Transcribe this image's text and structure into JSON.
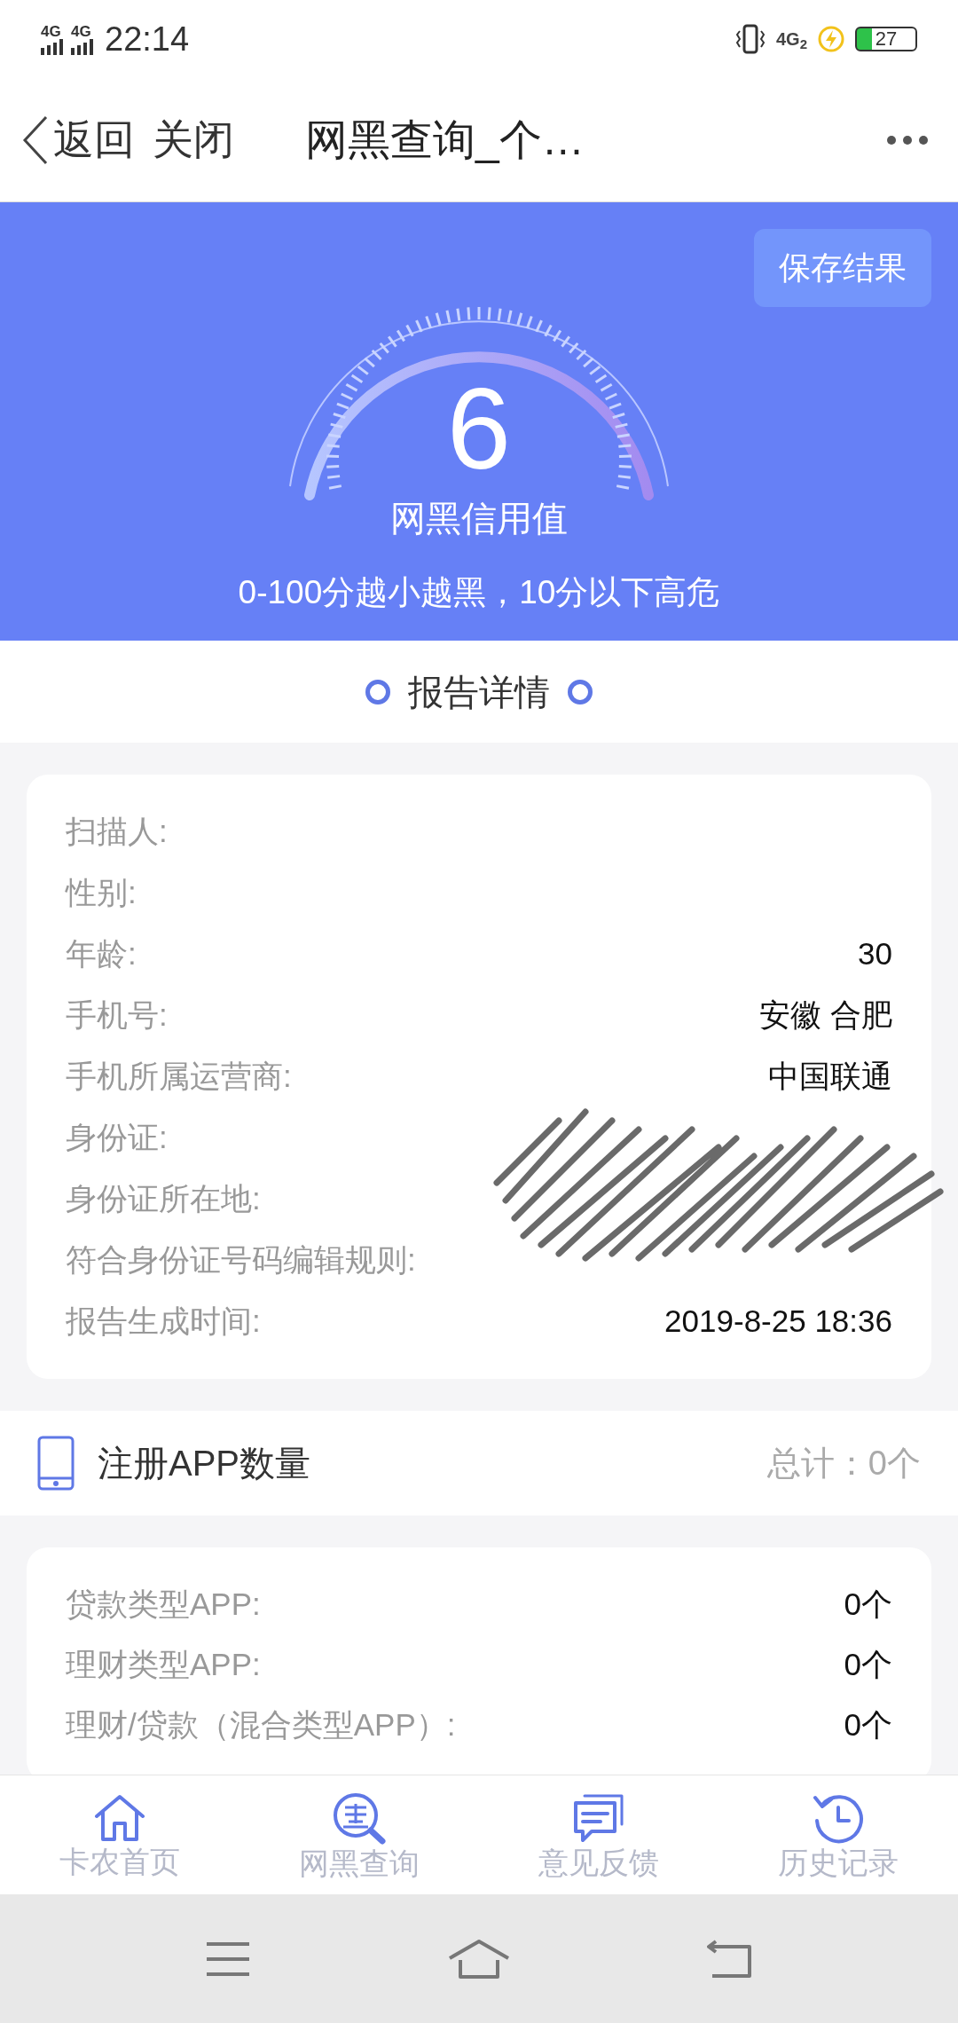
{
  "status_bar": {
    "signals": [
      "4G",
      "4G"
    ],
    "time": "22:14",
    "network": "4G$_{2}$",
    "battery": "27"
  },
  "nav_bar": {
    "back": "返回",
    "close": "关闭",
    "title": "网黑查询_个…"
  },
  "score_banner": {
    "save_button": "保存结果",
    "score": "6",
    "score_label": "网黑信用值",
    "note": "0-100分越小越黑，10分以下高危"
  },
  "report_heading": "报告详情",
  "report": [
    {
      "label": "扫描人:"
    },
    {
      "label": "性别:"
    },
    {
      "label": "年龄:",
      "value": "30"
    },
    {
      "label": "手机号:",
      "value": "安徽 合肥"
    },
    {
      "label": "手机所属运营商:",
      "value": "中国联通"
    },
    {
      "label": "身份证:"
    },
    {
      "label": "身份证所在地:"
    },
    {
      "label": "符合身份证号码编辑规则:"
    },
    {
      "label": "报告生成时间:",
      "value": "2019-8-25 18:36"
    }
  ],
  "apps_section": {
    "title": "注册APP数量",
    "total": "总计：0个"
  },
  "apps": [
    {
      "label": "贷款类型APP:",
      "value": "0个"
    },
    {
      "label": "理财类型APP:",
      "value": "0个"
    },
    {
      "label": "理财/贷款（混合类型APP）:",
      "value": "0个"
    }
  ],
  "tab_bar": [
    {
      "kind": "home",
      "label": "卡农首页"
    },
    {
      "kind": "search",
      "label": "网黑查询"
    },
    {
      "kind": "feedback",
      "label": "意见反馈"
    },
    {
      "kind": "history",
      "label": "历史记录"
    }
  ]
}
